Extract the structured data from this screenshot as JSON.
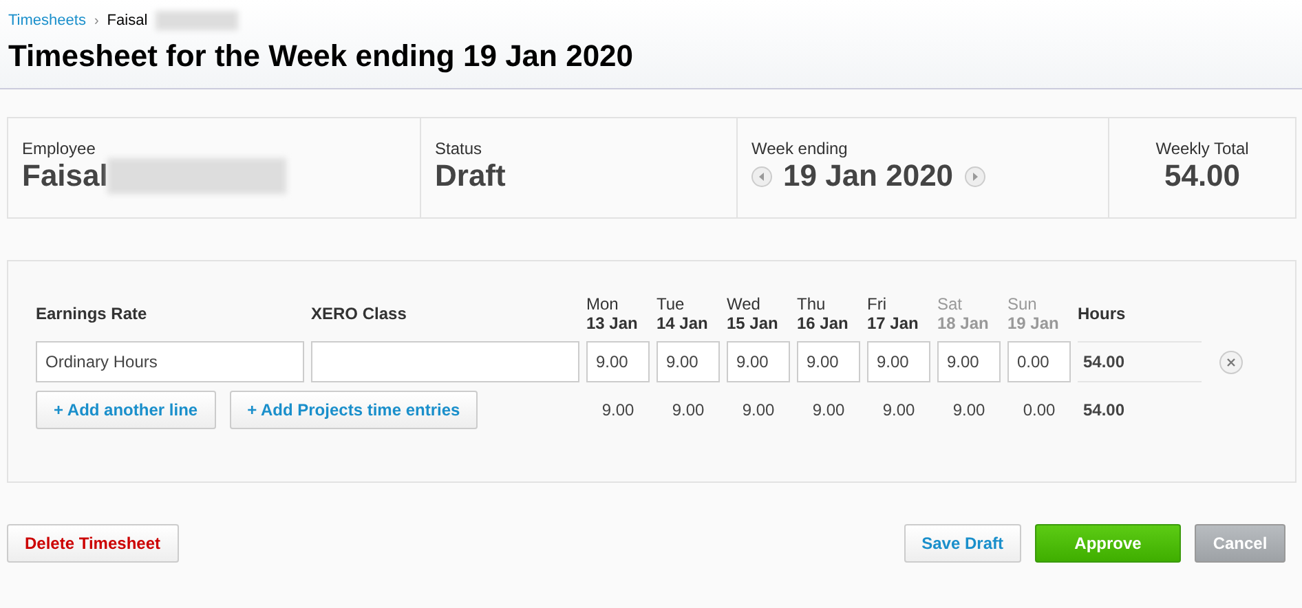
{
  "breadcrumb": {
    "link": "Timesheets",
    "separator": "›",
    "current": "Faisal",
    "current_redacted": true
  },
  "title": "Timesheet for the Week ending 19 Jan 2020",
  "summary": {
    "employee": {
      "label": "Employee",
      "value": "Faisal",
      "value_redacted": true
    },
    "status": {
      "label": "Status",
      "value": "Draft"
    },
    "week_ending": {
      "label": "Week ending",
      "value": "19 Jan 2020"
    },
    "weekly_total": {
      "label": "Weekly Total",
      "value": "54.00"
    }
  },
  "grid": {
    "columns": {
      "earnings_rate": "Earnings Rate",
      "class": "XERO Class",
      "hours": "Hours"
    },
    "days": [
      {
        "day": "Mon",
        "date": "13 Jan",
        "weekend": false
      },
      {
        "day": "Tue",
        "date": "14 Jan",
        "weekend": false
      },
      {
        "day": "Wed",
        "date": "15 Jan",
        "weekend": false
      },
      {
        "day": "Thu",
        "date": "16 Jan",
        "weekend": false
      },
      {
        "day": "Fri",
        "date": "17 Jan",
        "weekend": false
      },
      {
        "day": "Sat",
        "date": "18 Jan",
        "weekend": true
      },
      {
        "day": "Sun",
        "date": "19 Jan",
        "weekend": true
      }
    ],
    "rows": [
      {
        "earnings_rate": "Ordinary Hours",
        "class": "",
        "hours": [
          "9.00",
          "9.00",
          "9.00",
          "9.00",
          "9.00",
          "9.00",
          "0.00"
        ],
        "total": "54.00"
      }
    ],
    "totals": {
      "hours": [
        "9.00",
        "9.00",
        "9.00",
        "9.00",
        "9.00",
        "9.00",
        "0.00"
      ],
      "total": "54.00"
    },
    "add_buttons": [
      "+ Add another line",
      "+ Add Projects time entries"
    ]
  },
  "actions": {
    "delete": "Delete Timesheet",
    "save": "Save Draft",
    "approve": "Approve",
    "cancel": "Cancel"
  }
}
